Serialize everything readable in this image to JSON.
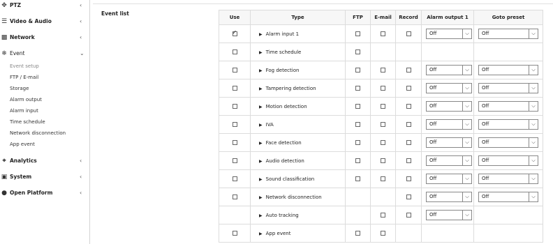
{
  "sidebar": {
    "ptz": {
      "label": "PTZ",
      "icon": "ptz-icon"
    },
    "video_audio": {
      "label": "Video & Audio",
      "icon": "sliders-icon"
    },
    "network": {
      "label": "Network",
      "icon": "network-icon"
    },
    "event": {
      "label": "Event",
      "icon": "event-icon"
    },
    "event_sub": [
      "Event setup",
      "FTP / E-mail",
      "Storage",
      "Alarm output",
      "Alarm input",
      "Time schedule",
      "Network disconnection",
      "App event"
    ],
    "analytics": {
      "label": "Analytics",
      "icon": "analytics-icon"
    },
    "system": {
      "label": "System",
      "icon": "system-icon"
    },
    "open_platform": {
      "label": "Open Platform",
      "icon": "open-platform-icon"
    }
  },
  "main": {
    "section_title": "Event list",
    "columns": [
      "Use",
      "Type",
      "FTP",
      "E-mail",
      "Record",
      "Alarm output 1",
      "Goto preset"
    ],
    "rows": [
      {
        "type": "Alarm input 1",
        "use": true,
        "ftp": false,
        "email": false,
        "record": false,
        "alarm": "Off",
        "preset": "Off"
      },
      {
        "type": "Time schedule",
        "use": false,
        "ftp": false,
        "email": null,
        "record": null,
        "alarm": null,
        "preset": null
      },
      {
        "type": "Fog detection",
        "use": false,
        "ftp": false,
        "email": false,
        "record": false,
        "alarm": "Off",
        "preset": "Off"
      },
      {
        "type": "Tampering detection",
        "use": false,
        "ftp": false,
        "email": false,
        "record": false,
        "alarm": "Off",
        "preset": "Off"
      },
      {
        "type": "Motion detection",
        "use": false,
        "ftp": false,
        "email": false,
        "record": false,
        "alarm": "Off",
        "preset": "Off"
      },
      {
        "type": "IVA",
        "use": false,
        "ftp": false,
        "email": false,
        "record": false,
        "alarm": "Off",
        "preset": "Off"
      },
      {
        "type": "Face detection",
        "use": false,
        "ftp": false,
        "email": false,
        "record": false,
        "alarm": "Off",
        "preset": "Off"
      },
      {
        "type": "Audio detection",
        "use": false,
        "ftp": false,
        "email": false,
        "record": false,
        "alarm": "Off",
        "preset": "Off"
      },
      {
        "type": "Sound classification",
        "use": false,
        "ftp": false,
        "email": false,
        "record": false,
        "alarm": "Off",
        "preset": "Off"
      },
      {
        "type": "Network disconnection",
        "use": false,
        "ftp": null,
        "email": null,
        "record": false,
        "alarm": "Off",
        "preset": "Off"
      },
      {
        "type": "Auto tracking",
        "use": null,
        "ftp": null,
        "email": false,
        "record": false,
        "alarm": "Off",
        "preset": null
      },
      {
        "type": "App event",
        "use": false,
        "ftp": false,
        "email": false,
        "record": null,
        "alarm": null,
        "preset": null
      }
    ]
  }
}
